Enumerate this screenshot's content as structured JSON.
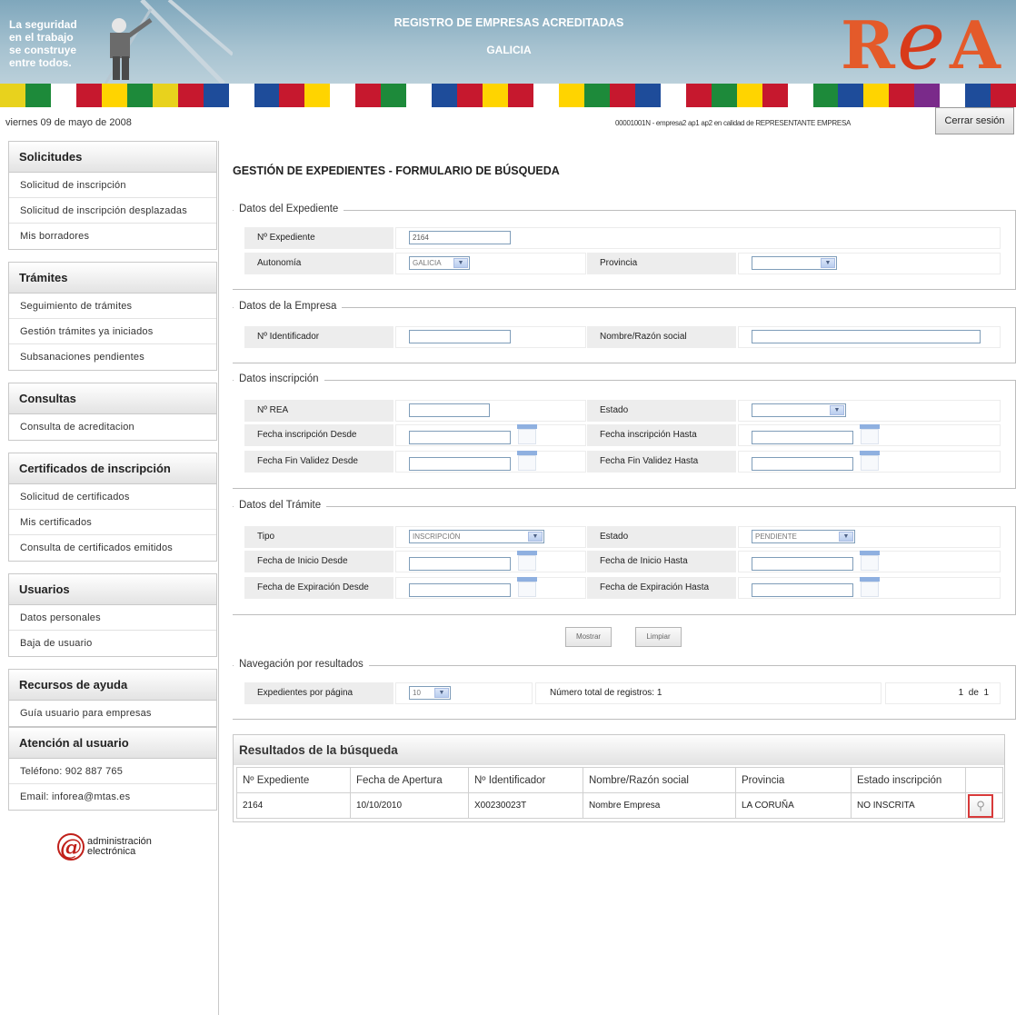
{
  "header": {
    "slogan": [
      "La seguridad",
      "en el trabajo",
      "se construye",
      "entre todos."
    ],
    "title": "REGISTRO DE EMPRESAS ACREDITADAS",
    "subtitle": "GALICIA",
    "logo_text": "REA",
    "flag_colors": [
      "#e8d21d",
      "#1d8a3a",
      "#ffffff",
      "#c6182e",
      "#ffd400",
      "#1d8a3a",
      "#e8d21d",
      "#c6182e",
      "#1e4c9a",
      "#ffffff",
      "#1e4c9a",
      "#c6182e",
      "#ffd400",
      "#ffffff",
      "#c6182e",
      "#1d8a3a",
      "#ffffff",
      "#1e4c9a",
      "#c6182e",
      "#ffd400",
      "#c6182e",
      "#ffffff",
      "#ffd400",
      "#1d8a3a",
      "#c6182e",
      "#1e4c9a",
      "#ffffff",
      "#c6182e",
      "#1d8a3a",
      "#ffd400",
      "#c6182e",
      "#ffffff",
      "#1d8a3a",
      "#1e4c9a",
      "#ffd400",
      "#c6182e",
      "#7a2a8a",
      "#ffffff",
      "#1e4c9a",
      "#c6182e"
    ]
  },
  "topbar": {
    "date": "viernes 09 de mayo de 2008",
    "user_info": "00001001N - empresa2 ap1 ap2 en calidad de REPRESENTANTE EMPRESA",
    "logout_label": "Cerrar sesión"
  },
  "sidebar": {
    "sections": [
      {
        "title": "Solicitudes",
        "items": [
          "Solicitud de inscripción",
          "Solicitud de inscripción desplazadas",
          "Mis borradores"
        ]
      },
      {
        "title": "Trámites",
        "items": [
          "Seguimiento de trámites",
          "Gestión trámites ya iniciados",
          "Subsanaciones pendientes"
        ]
      },
      {
        "title": "Consultas",
        "items": [
          "Consulta de acreditacion"
        ]
      },
      {
        "title": "Certificados de inscripción",
        "items": [
          "Solicitud de certificados",
          "Mis certificados",
          "Consulta de certificados emitidos"
        ]
      },
      {
        "title": "Usuarios",
        "items": [
          "Datos personales",
          "Baja de usuario"
        ]
      },
      {
        "title": "Recursos de ayuda",
        "items": [
          "Guía usuario para empresas"
        ]
      },
      {
        "title": "Atención al usuario",
        "items": [
          "Teléfono: 902 887 765",
          "Email: inforea@mtas.es"
        ]
      }
    ],
    "admin_logo": {
      "letter": "@",
      "line1": "administración",
      "line2": "electrónica"
    }
  },
  "main": {
    "page_title": "GESTIÓN DE EXPEDIENTES - FORMULARIO DE BÚSQUEDA",
    "expediente": {
      "legend": "Datos del Expediente",
      "num_label": "Nº Expediente",
      "num_value": "2164",
      "autonomia_label": "Autonomía",
      "autonomia_value": "GALICIA",
      "provincia_label": "Provincia",
      "provincia_value": ""
    },
    "empresa": {
      "legend": "Datos de la Empresa",
      "id_label": "Nº Identificador",
      "id_value": "",
      "nombre_label": "Nombre/Razón social",
      "nombre_value": ""
    },
    "inscripcion": {
      "legend": "Datos inscripción",
      "rea_label": "Nº REA",
      "estado_label": "Estado",
      "fi_desde_label": "Fecha inscripción Desde",
      "fi_hasta_label": "Fecha inscripción Hasta",
      "fv_desde_label": "Fecha Fin Validez Desde",
      "fv_hasta_label": "Fecha Fin Validez Hasta"
    },
    "tramite": {
      "legend": "Datos del Trámite",
      "tipo_label": "Tipo",
      "tipo_value": "INSCRIPCIÓN",
      "estado_label": "Estado",
      "estado_value": "PENDIENTE",
      "inicio_desde_label": "Fecha de Inicio Desde",
      "inicio_hasta_label": "Fecha de Inicio Hasta",
      "exp_desde_label": "Fecha de Expiración Desde",
      "exp_hasta_label": "Fecha de Expiración Hasta"
    },
    "buttons": {
      "show": "Mostrar",
      "clear": "Limpiar"
    },
    "navegacion": {
      "legend": "Navegación por resultados",
      "per_page_label": "Expedientes por página",
      "per_page_value": "10",
      "total_label": "Número total de registros: 1",
      "page": "1  de  1"
    },
    "results": {
      "title": "Resultados de la búsqueda",
      "columns": [
        "Nº Expediente",
        "Fecha de Apertura",
        "Nº Identificador",
        "Nombre/Razón social",
        "Provincia",
        "Estado inscripción"
      ],
      "rows": [
        [
          "2164",
          "10/10/2010",
          "X00230023T",
          "Nombre Empresa",
          "LA CORUÑA",
          "NO INSCRITA"
        ]
      ]
    }
  }
}
